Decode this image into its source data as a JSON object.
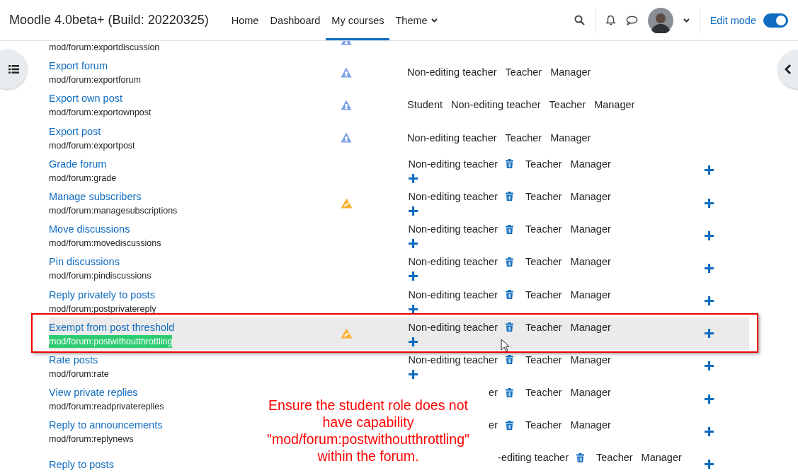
{
  "header": {
    "site_title": "Moodle 4.0beta+ (Build: 20220325)",
    "nav": [
      {
        "label": "Home",
        "selected": false,
        "dropdown": false
      },
      {
        "label": "Dashboard",
        "selected": false,
        "dropdown": false
      },
      {
        "label": "My courses",
        "selected": true,
        "dropdown": false
      },
      {
        "label": "Theme",
        "selected": false,
        "dropdown": true
      }
    ],
    "edit_mode": {
      "label": "Edit mode",
      "on": true
    }
  },
  "rows": [
    {
      "name": "",
      "capability": "mod/forum:exportdiscussion",
      "risk_icon": {
        "kind": "personal"
      },
      "roles": [],
      "add_role": false,
      "add_prohibit": false,
      "selected": false
    },
    {
      "name": "Export forum",
      "capability": "mod/forum:exportforum",
      "risk_icon": {
        "kind": "personal"
      },
      "roles": [
        {
          "name": "Non-editing teacher",
          "deletable": false
        },
        {
          "name": "Teacher",
          "deletable": false
        },
        {
          "name": "Manager",
          "deletable": false
        }
      ],
      "add_role": false,
      "add_prohibit": false,
      "selected": false
    },
    {
      "name": "Export own post",
      "capability": "mod/forum:exportownpost",
      "risk_icon": {
        "kind": "personal"
      },
      "roles": [
        {
          "name": "Student",
          "deletable": false
        },
        {
          "name": "Non-editing teacher",
          "deletable": false
        },
        {
          "name": "Teacher",
          "deletable": false
        },
        {
          "name": "Manager",
          "deletable": false
        }
      ],
      "add_role": false,
      "add_prohibit": false,
      "selected": false
    },
    {
      "name": "Export post",
      "capability": "mod/forum:exportpost",
      "risk_icon": {
        "kind": "personal"
      },
      "roles": [
        {
          "name": "Non-editing teacher",
          "deletable": false
        },
        {
          "name": "Teacher",
          "deletable": false
        },
        {
          "name": "Manager",
          "deletable": false
        }
      ],
      "add_role": false,
      "add_prohibit": false,
      "selected": false
    },
    {
      "name": "Grade forum",
      "capability": "mod/forum:grade",
      "roles": [
        {
          "name": "Non-editing teacher",
          "deletable": true
        },
        {
          "name": "Teacher",
          "deletable": false
        },
        {
          "name": "Manager",
          "deletable": false
        }
      ],
      "add_role": true,
      "add_prohibit": true,
      "selected": false
    },
    {
      "name": "Manage subscribers",
      "capability": "mod/forum:managesubscriptions",
      "risk_icon": {
        "kind": "spam"
      },
      "roles": [
        {
          "name": "Non-editing teacher",
          "deletable": true
        },
        {
          "name": "Teacher",
          "deletable": false
        },
        {
          "name": "Manager",
          "deletable": false
        }
      ],
      "add_role": true,
      "add_prohibit": true,
      "selected": false
    },
    {
      "name": "Move discussions",
      "capability": "mod/forum:movediscussions",
      "roles": [
        {
          "name": "Non-editing teacher",
          "deletable": true
        },
        {
          "name": "Teacher",
          "deletable": false
        },
        {
          "name": "Manager",
          "deletable": false
        }
      ],
      "add_role": true,
      "add_prohibit": true,
      "selected": false
    },
    {
      "name": "Pin discussions",
      "capability": "mod/forum:pindiscussions",
      "roles": [
        {
          "name": "Non-editing teacher",
          "deletable": true
        },
        {
          "name": "Teacher",
          "deletable": false
        },
        {
          "name": "Manager",
          "deletable": false
        }
      ],
      "add_role": true,
      "add_prohibit": true,
      "selected": false
    },
    {
      "name": "Reply privately to posts",
      "capability": "mod/forum:postprivatereply",
      "roles": [
        {
          "name": "Non-editing teacher",
          "deletable": true
        },
        {
          "name": "Teacher",
          "deletable": false
        },
        {
          "name": "Manager",
          "deletable": false
        }
      ],
      "add_role": true,
      "add_prohibit": true,
      "selected": false
    },
    {
      "name": "Exempt from post threshold",
      "capability": "mod/forum:postwithoutthrottling",
      "highlighted": true,
      "risk_icon": {
        "kind": "spam"
      },
      "roles": [
        {
          "name": "Non-editing teacher",
          "deletable": true
        },
        {
          "name": "Teacher",
          "deletable": false
        },
        {
          "name": "Manager",
          "deletable": false
        }
      ],
      "add_role": true,
      "add_prohibit": true,
      "selected": true
    },
    {
      "name": "Rate posts",
      "capability": "mod/forum:rate",
      "roles": [
        {
          "name": "Non-editing teacher",
          "deletable": true
        },
        {
          "name": "Teacher",
          "deletable": false
        },
        {
          "name": "Manager",
          "deletable": false
        }
      ],
      "add_role": true,
      "add_prohibit": true,
      "selected": false
    },
    {
      "name": "View private replies",
      "capability": "mod/forum:readprivatereplies",
      "roles": [
        {
          "name": "er",
          "deletable": true
        },
        {
          "name": "Teacher",
          "deletable": false
        },
        {
          "name": "Manager",
          "deletable": false
        }
      ],
      "add_role": false,
      "add_prohibit": true,
      "selected": false
    },
    {
      "name": "Reply to announcements",
      "capability": "mod/forum:replynews",
      "roles": [
        {
          "name": "er",
          "deletable": true
        },
        {
          "name": "Teacher",
          "deletable": false
        },
        {
          "name": "Manager",
          "deletable": false
        }
      ],
      "add_role": false,
      "add_prohibit": true,
      "selected": false
    },
    {
      "name": "Reply to posts",
      "capability": "",
      "roles": [
        {
          "name": "-editing teacher",
          "deletable": true
        },
        {
          "name": "Teacher",
          "deletable": false
        },
        {
          "name": "Manager",
          "deletable": false
        }
      ],
      "add_role": false,
      "add_prohibit": true,
      "selected": false
    }
  ],
  "annotation": "Ensure the student role does not\nhave capability\n\"mod/forum:postwithoutthrottling\"\nwithin the forum."
}
